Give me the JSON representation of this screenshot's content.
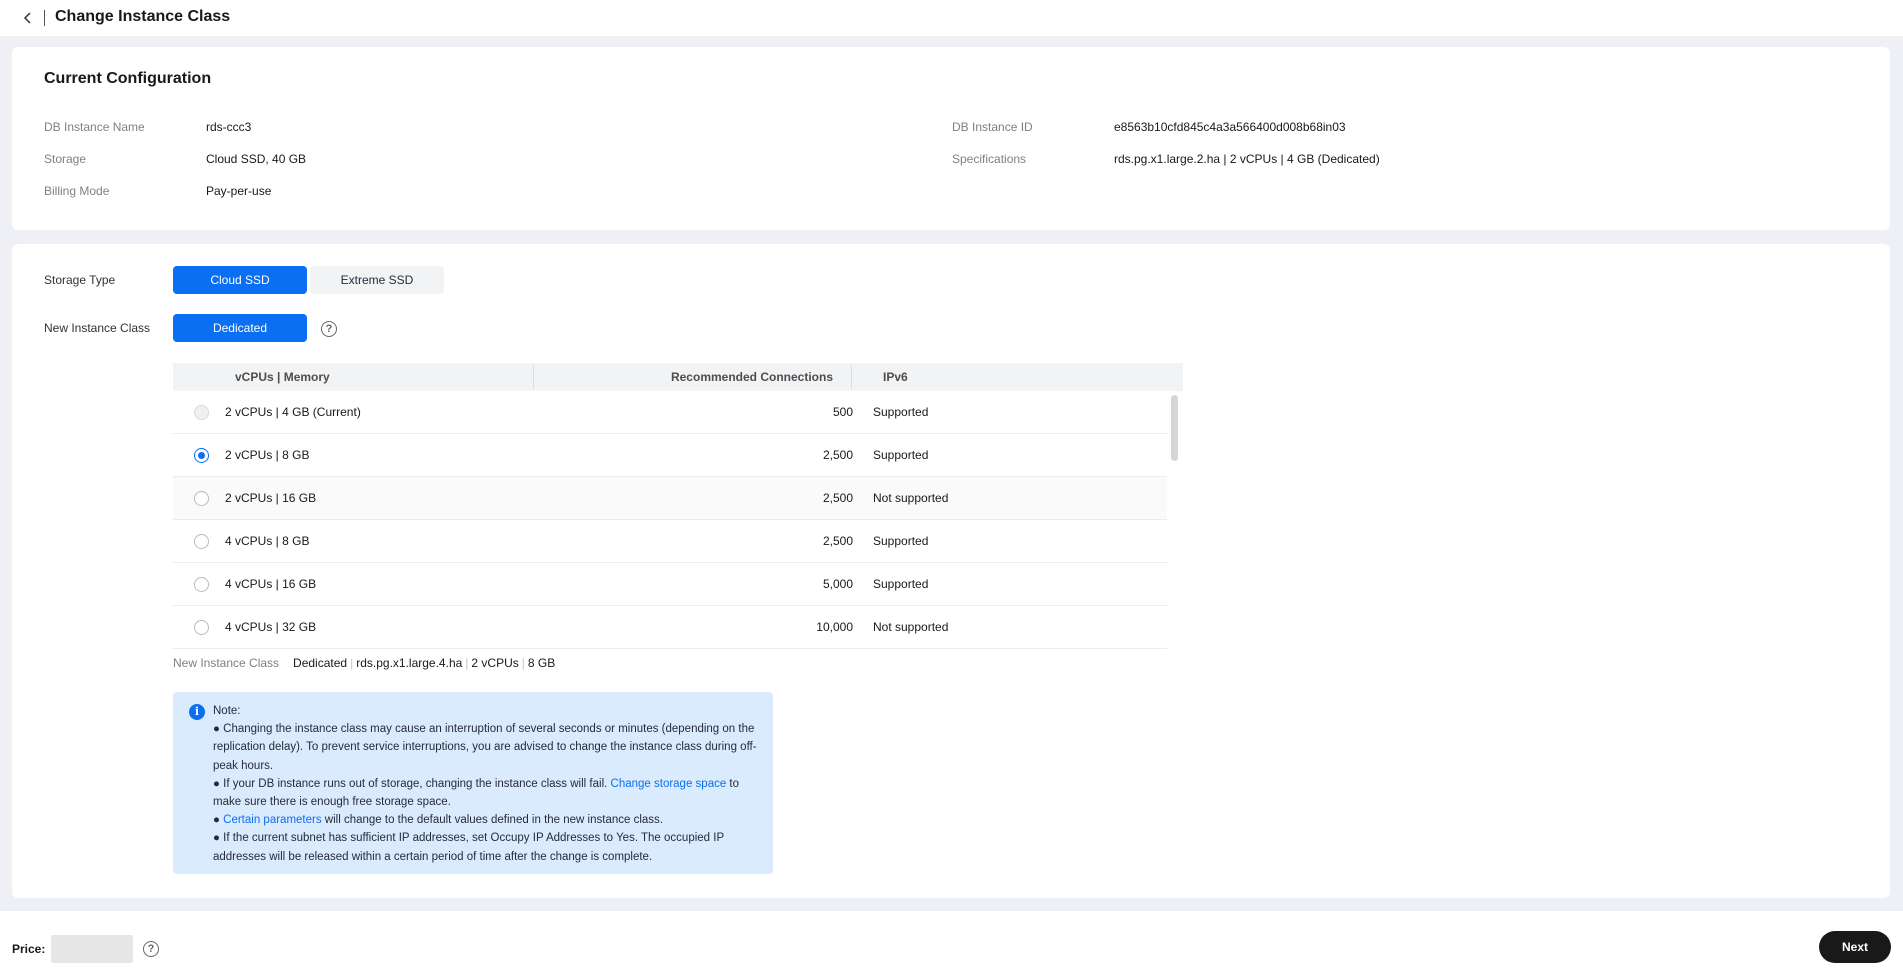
{
  "header": {
    "title": "Change Instance Class"
  },
  "current_config": {
    "title": "Current Configuration",
    "left": [
      {
        "label": "DB Instance Name",
        "value": "rds-ccc3"
      },
      {
        "label": "Storage",
        "value": "Cloud SSD, 40 GB"
      },
      {
        "label": "Billing Mode",
        "value": "Pay-per-use"
      }
    ],
    "right": [
      {
        "label": "DB Instance ID",
        "value": "e8563b10cfd845c4a3a566400d008b68in03"
      },
      {
        "label": "Specifications",
        "value": "rds.pg.x1.large.2.ha | 2 vCPUs | 4 GB (Dedicated)"
      }
    ]
  },
  "form": {
    "storage_type": {
      "label": "Storage Type",
      "options": [
        "Cloud SSD",
        "Extreme SSD"
      ],
      "selected": "Cloud SSD"
    },
    "instance_class": {
      "label": "New Instance Class",
      "options": [
        "Dedicated"
      ],
      "selected": "Dedicated"
    },
    "table": {
      "headers": [
        "vCPUs | Memory",
        "Recommended Connections",
        "IPv6"
      ],
      "rows": [
        {
          "spec": "2 vCPUs | 4 GB (Current)",
          "connections": "500",
          "ipv6": "Supported",
          "state": "disabled"
        },
        {
          "spec": "2 vCPUs | 8 GB",
          "connections": "2,500",
          "ipv6": "Supported",
          "state": "checked"
        },
        {
          "spec": "2 vCPUs | 16 GB",
          "connections": "2,500",
          "ipv6": "Not supported",
          "state": "unchecked"
        },
        {
          "spec": "4 vCPUs | 8 GB",
          "connections": "2,500",
          "ipv6": "Supported",
          "state": "unchecked"
        },
        {
          "spec": "4 vCPUs | 16 GB",
          "connections": "5,000",
          "ipv6": "Supported",
          "state": "unchecked"
        },
        {
          "spec": "4 vCPUs | 32 GB",
          "connections": "10,000",
          "ipv6": "Not supported",
          "state": "unchecked"
        }
      ]
    },
    "summary": {
      "label": "New Instance Class",
      "parts": [
        "Dedicated",
        "rds.pg.x1.large.4.ha",
        "2 vCPUs",
        "8 GB"
      ]
    },
    "note": {
      "title": "Note:",
      "p1": "● Changing the instance class may cause an interruption of several seconds or minutes (depending on the replication delay). To prevent service interruptions, you are advised to change the instance class during off-peak hours.",
      "p2_before": "● If your DB instance runs out of storage, changing the instance class will fail. ",
      "p2_link": "Change storage space",
      "p2_after": " to make sure there is enough free storage space.",
      "p3_before": "● ",
      "p3_link": "Certain parameters",
      "p3_after": " will change to the default values defined in the new instance class.",
      "p4": "● If the current subnet has sufficient IP addresses, set Occupy IP Addresses to Yes. The occupied IP addresses will be released within a certain period of time after the change is complete."
    }
  },
  "footer": {
    "price_label": "Price:",
    "next_label": "Next"
  },
  "colors": {
    "accent": "#0a6ff0",
    "note_bg": "#dbebfe",
    "page_bg": "#eff0f5"
  }
}
